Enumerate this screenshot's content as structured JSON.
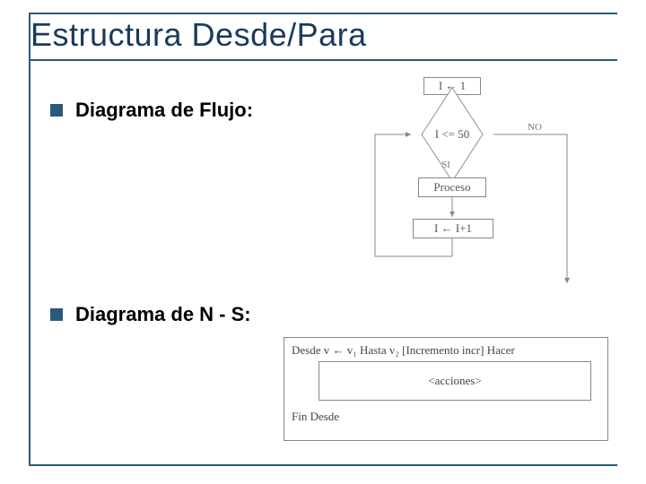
{
  "title": "Estructura Desde/Para",
  "bullets": {
    "flow_label": "Diagrama de Flujo:",
    "ns_label": "Diagrama de N - S:"
  },
  "flowchart": {
    "init": "I ← 1",
    "cond": "I <= 50",
    "yes": "SI",
    "no": "NO",
    "process": "Proceso",
    "incr": "I ← I+1"
  },
  "ns": {
    "header": "Desde v ← v₁ Hasta v₂ [Incremento incr] Hacer",
    "body": "<acciones>",
    "footer": "Fin Desde"
  }
}
